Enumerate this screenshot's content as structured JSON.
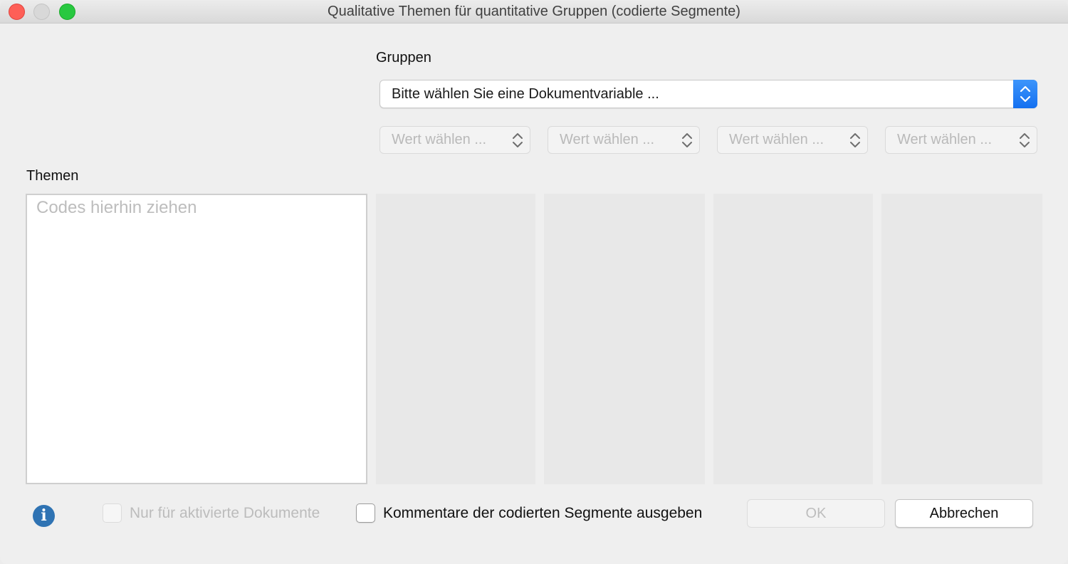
{
  "window": {
    "title": "Qualitative Themen für quantitative Gruppen (codierte Segmente)"
  },
  "groups": {
    "label": "Gruppen",
    "variable_select": "Bitte wählen Sie eine Dokumentvariable ...",
    "value_selects": [
      "Wert wählen ...",
      "Wert wählen ...",
      "Wert wählen ...",
      "Wert wählen ..."
    ]
  },
  "themes": {
    "label": "Themen",
    "dropzone_placeholder": "Codes hierhin ziehen"
  },
  "footer": {
    "checkbox_active_docs": "Nur für aktivierte Dokumente",
    "checkbox_comments": "Kommentare der codierten Segmente ausgeben",
    "ok_label": "OK",
    "cancel_label": "Abbrechen"
  },
  "icons": {
    "info": "info-icon",
    "stepper": "up-down-chevron-icon"
  },
  "colors": {
    "accent": "#1a74f2",
    "info": "#2f73b3",
    "close": "#fe5f57",
    "maximize": "#28c840"
  }
}
